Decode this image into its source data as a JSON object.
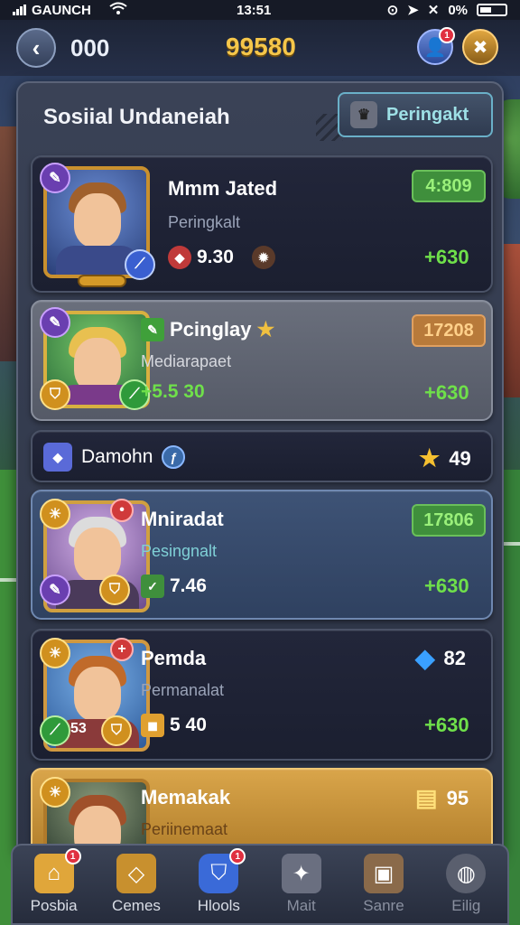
{
  "status_bar": {
    "carrier": "GAUNCH",
    "time": "13:51",
    "battery": "0%"
  },
  "top_bar": {
    "count": "000",
    "coins": "99580",
    "profile_notifications": "1"
  },
  "panel": {
    "title": "Sosiial Undaneiah",
    "rank_button_label": "Peringakt"
  },
  "cards": [
    {
      "name": "Mmm Jated",
      "subtitle": "Peringkalt",
      "stat": "9.30",
      "pill": "4:809",
      "value": "+630"
    },
    {
      "name": "Pcinglay",
      "subtitle": "Mediarapaet",
      "stat": "+5.5 30",
      "pill": "17208",
      "value": "+630"
    },
    {
      "name": "Damohn",
      "value": "49"
    },
    {
      "name": "Mniradat",
      "subtitle": "Pesingnalt",
      "stat": "7.46",
      "pill": "17806",
      "value": "+630"
    },
    {
      "name": "Pemda",
      "subtitle": "Permanalat",
      "badge_number": "53",
      "stat": "5 40",
      "gem_value": "82",
      "value": "+630"
    },
    {
      "name": "Memakak",
      "subtitle": "Periinemaat",
      "value": "95"
    }
  ],
  "nav": [
    {
      "label": "Posbia",
      "badge": "1"
    },
    {
      "label": "Cemes"
    },
    {
      "label": "Hlools",
      "badge": "1"
    },
    {
      "label": "Mait"
    },
    {
      "label": "Sanre"
    },
    {
      "label": "Eilig"
    }
  ],
  "colors": {
    "accent_gold": "#f5c64a",
    "positive_green": "#6fe04a",
    "rank_cyan": "#9ee0e6"
  }
}
